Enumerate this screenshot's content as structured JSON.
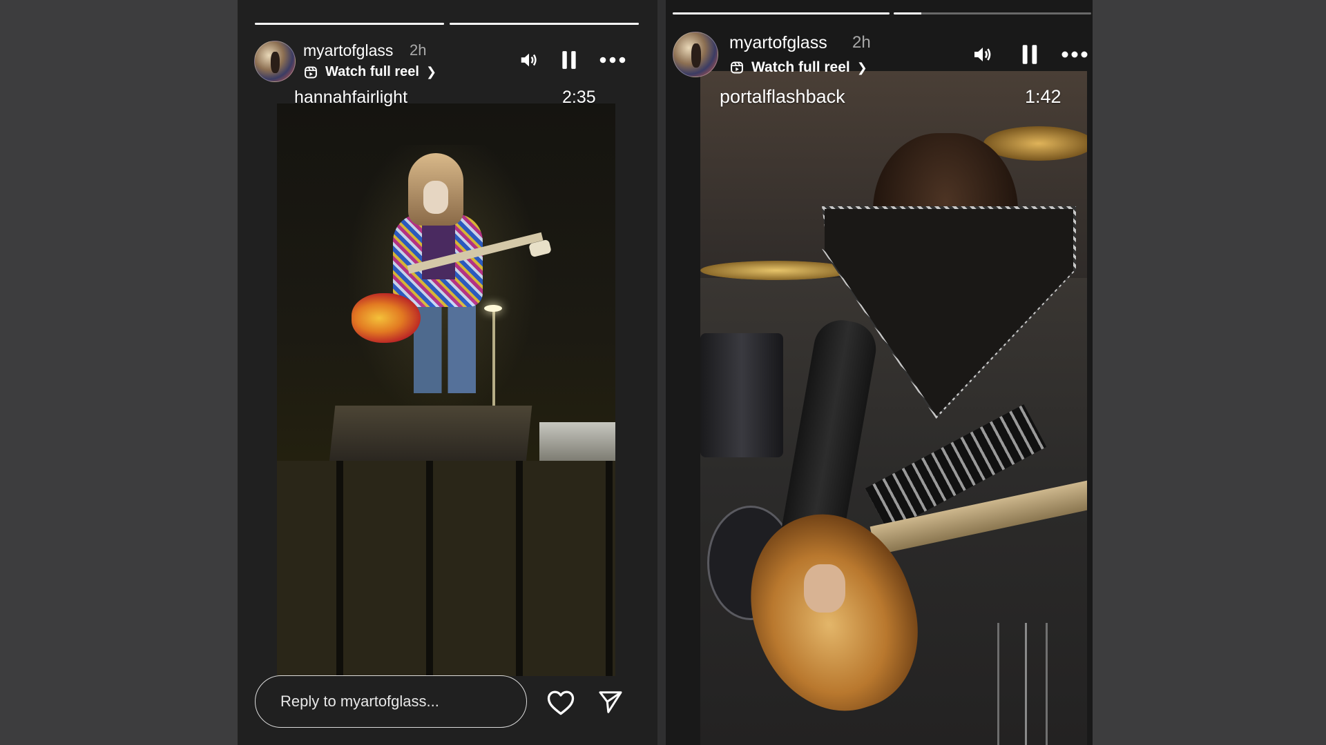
{
  "stories": [
    {
      "username": "myartofglass",
      "time": "2h",
      "watch_label": "Watch full reel",
      "reel_handle": "hannahfairlight",
      "duration": "2:35",
      "progress": [
        1.0,
        1.0
      ],
      "reply_placeholder": "Reply to myartofglass..."
    },
    {
      "username": "myartofglass",
      "time": "2h",
      "watch_label": "Watch full reel",
      "reel_handle": "portalflashback",
      "duration": "1:42",
      "progress": [
        1.0,
        0.14
      ]
    }
  ],
  "icons": {
    "sound": "speaker-icon",
    "pause": "pause-icon",
    "more": "more-icon",
    "reel": "reel-icon",
    "like": "heart-icon",
    "share": "send-icon"
  },
  "colors": {
    "background": "#3d3d3e",
    "story_bg": "#202020",
    "text": "#ffffff"
  }
}
